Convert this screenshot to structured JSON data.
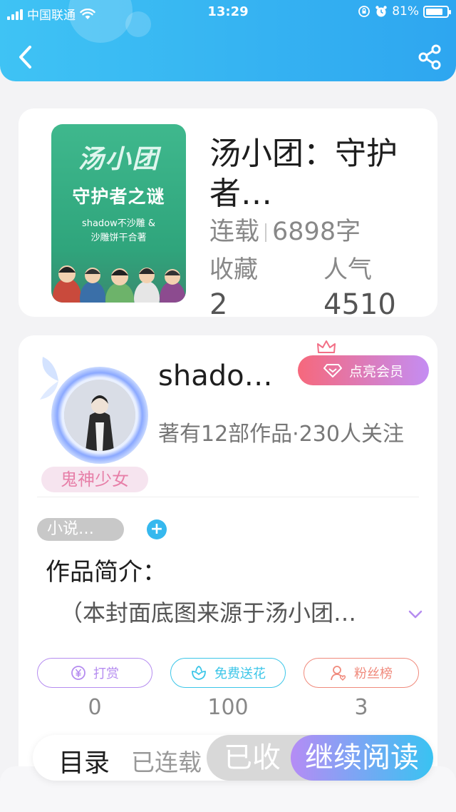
{
  "status_bar": {
    "carrier": "中国联通",
    "time": "13:29",
    "battery": "81%",
    "battery_level": 0.81
  },
  "book": {
    "title": "汤小团：守护者…",
    "cover": {
      "title_line1": "汤小团",
      "title_line2": "守护者之谜",
      "authors_line1": "shadow不沙雕 &",
      "authors_line2": "沙雕饼干合著"
    },
    "status": "连载",
    "word_count": "6898字",
    "favorites_label": "收藏",
    "favorites_value": "2",
    "popularity_label": "人气",
    "popularity_value": "4510"
  },
  "author": {
    "name": "shado…",
    "badge": "鬼神少女",
    "meta": "著有12部作品·230人关注",
    "vip_label": "点亮会员"
  },
  "tags": {
    "first": "小说…"
  },
  "intro": {
    "heading": "作品简介：",
    "text": "（本封面底图来源于汤小团…"
  },
  "actions": [
    {
      "label": "打赏",
      "count": "0",
      "color": "#b58cf0",
      "icon": "yuan-coin-icon"
    },
    {
      "label": "免费送花",
      "count": "100",
      "color": "#3cc6e8",
      "icon": "flower-icon"
    },
    {
      "label": "粉丝榜",
      "count": "3",
      "color": "#f08a7c",
      "icon": "fans-icon"
    }
  ],
  "bottom_bar": {
    "catalog": "目录",
    "status": "已连载",
    "collected": "已收",
    "continue": "继续阅读"
  }
}
